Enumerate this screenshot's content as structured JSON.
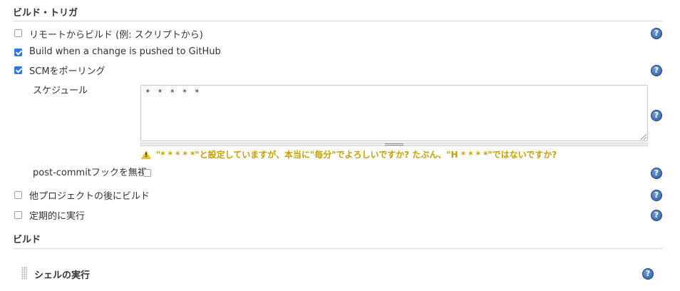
{
  "sections": {
    "build_triggers_title": "ビルド・トリガ",
    "build_title": "ビルド"
  },
  "triggers": {
    "remote_build": {
      "label": "リモートからビルド (例: スクリプトから)",
      "checked": false
    },
    "github_push": {
      "label": "Build when a change is pushed to GitHub",
      "checked": true
    },
    "scm_polling": {
      "label": "SCMをポーリング",
      "checked": true
    },
    "schedule": {
      "label": "スケジュール",
      "value": "* * * * *"
    },
    "warning": "\"* * * * *\"と設定していますが、本当に\"毎分\"でよろしいですか? たぶん、\"H * * * *\"ではないですか?",
    "post_commit": {
      "label": "post-commitフックを無視",
      "checked": false
    },
    "after_other": {
      "label": "他プロジェクトの後にビルド",
      "checked": false
    },
    "periodic": {
      "label": "定期的に実行",
      "checked": false
    }
  },
  "build": {
    "step_title": "シェルの実行"
  },
  "help_glyph": "?",
  "icons": {
    "help": "help-icon",
    "warning": "warning-icon",
    "drag": "drag-handle-icon"
  },
  "colors": {
    "checkbox_checked": "#2a7ae2",
    "warning_text": "#c6a000",
    "help_icon": "#2b5d9e"
  }
}
